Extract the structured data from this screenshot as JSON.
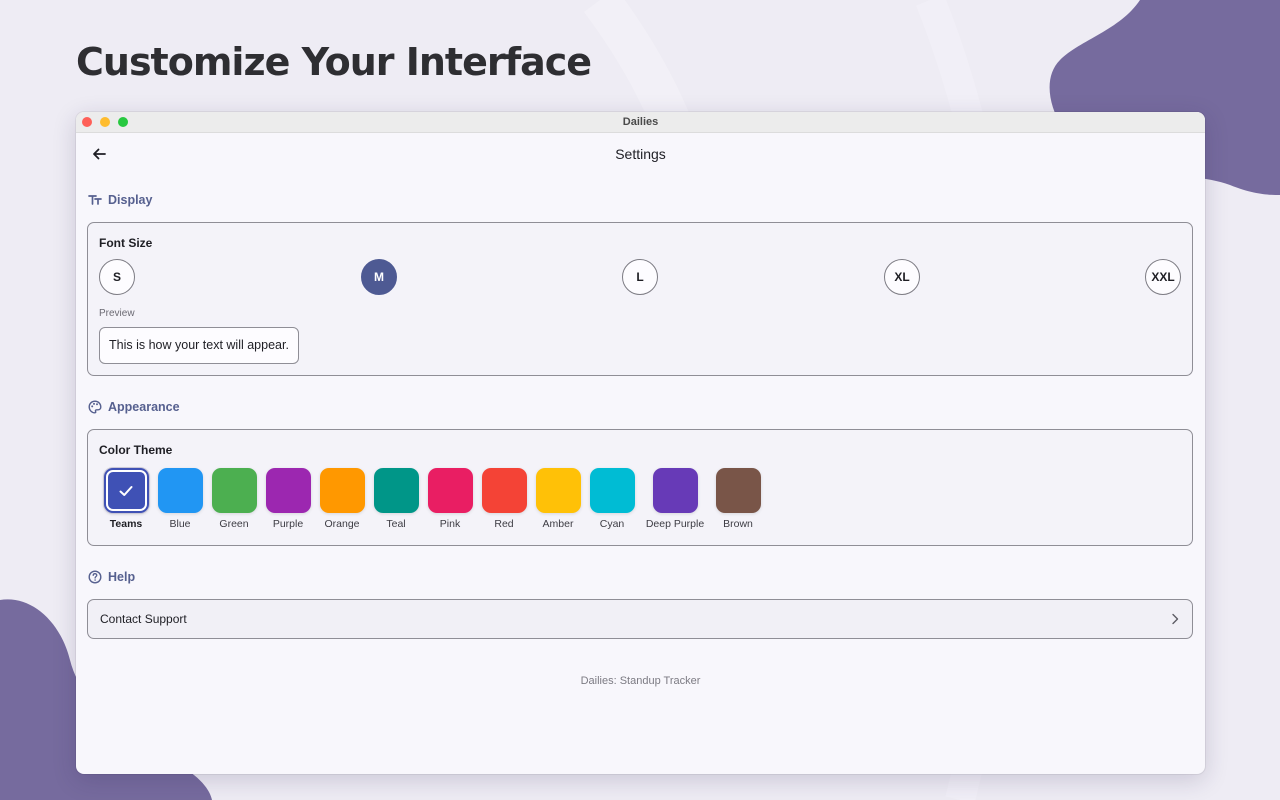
{
  "hero": {
    "title": "Customize Your Interface"
  },
  "window": {
    "title": "Dailies"
  },
  "appbar": {
    "title": "Settings",
    "back_icon": "arrow-left-icon"
  },
  "sections": {
    "display": {
      "label": "Display",
      "icon": "text-size-icon"
    },
    "appearance": {
      "label": "Appearance",
      "icon": "palette-icon"
    },
    "help": {
      "label": "Help",
      "icon": "help-circle-icon"
    }
  },
  "font_size": {
    "label": "Font Size",
    "options": [
      "S",
      "M",
      "L",
      "XL",
      "XXL"
    ],
    "selected": "M",
    "preview_label": "Preview",
    "preview_text": "This is how your text will appear."
  },
  "color_theme": {
    "label": "Color Theme",
    "selected": "Teams",
    "themes": [
      {
        "name": "Teams",
        "color": "#3f51b5"
      },
      {
        "name": "Blue",
        "color": "#2196f3"
      },
      {
        "name": "Green",
        "color": "#4caf50"
      },
      {
        "name": "Purple",
        "color": "#9c27b0"
      },
      {
        "name": "Orange",
        "color": "#ff9800"
      },
      {
        "name": "Teal",
        "color": "#009688"
      },
      {
        "name": "Pink",
        "color": "#e91e63"
      },
      {
        "name": "Red",
        "color": "#f44336"
      },
      {
        "name": "Amber",
        "color": "#ffc107"
      },
      {
        "name": "Cyan",
        "color": "#00bcd4"
      },
      {
        "name": "Deep Purple",
        "color": "#673ab7"
      },
      {
        "name": "Brown",
        "color": "#795548"
      }
    ]
  },
  "help": {
    "contact_label": "Contact Support",
    "chevron_icon": "chevron-right-icon"
  },
  "footer": {
    "text": "Dailies: Standup Tracker"
  },
  "colors": {
    "accent": "#4e5a93",
    "blob": "#766b9e",
    "section_header": "#56608f"
  }
}
